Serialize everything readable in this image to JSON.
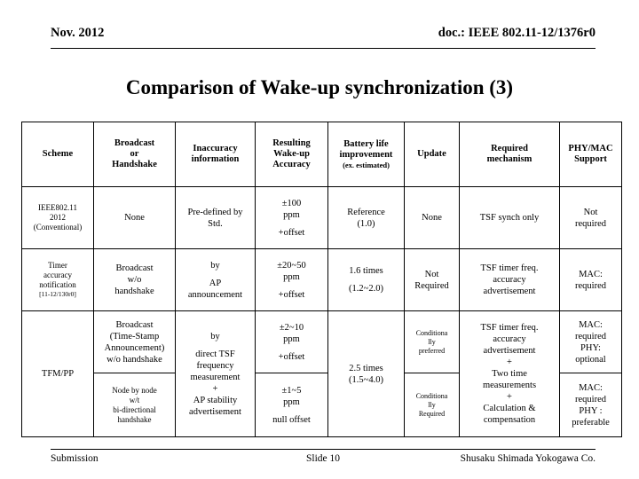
{
  "header": {
    "date": "Nov. 2012",
    "doc": "doc.: IEEE 802.11-12/1376r0"
  },
  "title": "Comparison of Wake-up synchronization (3)",
  "table": {
    "columns": [
      "Scheme",
      "Broadcast or Handshake",
      "Inaccuracy information",
      "Resulting Wake-up Accuracy",
      "Battery life improvement (ex. estimated)",
      "Update",
      "Required mechanism",
      "PHY/MAC Support"
    ],
    "header_cells": {
      "scheme": "Scheme",
      "broadcast_l1": "Broadcast",
      "broadcast_l2": "or",
      "broadcast_l3": "Handshake",
      "inaccuracy_l1": "Inaccuracy",
      "inaccuracy_l2": "information",
      "accuracy_l1": "Resulting",
      "accuracy_l2": "Wake-up",
      "accuracy_l3": "Accuracy",
      "battery_l1": "Battery life",
      "battery_l2": "improvement",
      "battery_l3": "(ex. estimated)",
      "update": "Update",
      "mechanism_l1": "Required",
      "mechanism_l2": "mechanism",
      "phymac_l1": "PHY/MAC",
      "phymac_l2": "Support"
    },
    "row1": {
      "scheme_l1": "IEEE802.11",
      "scheme_l2": "2012",
      "scheme_l3": "(Conventional)",
      "broadcast": "None",
      "inaccuracy_l1": "Pre-defined by",
      "inaccuracy_l2": "Std.",
      "accuracy_l1": "±100",
      "accuracy_l2": "ppm",
      "accuracy_l3": "+offset",
      "battery_l1": "Reference",
      "battery_l2": "(1.0)",
      "update": "None",
      "mechanism": "TSF synch only",
      "phymac_l1": "Not",
      "phymac_l2": "required"
    },
    "row2": {
      "scheme_l1": "Timer",
      "scheme_l2": "accuracy",
      "scheme_l3": "notification",
      "scheme_l4": "[11-12/130r0]",
      "broadcast_l1": "Broadcast",
      "broadcast_l2": "w/o",
      "broadcast_l3": "handshake",
      "inaccuracy_l1": "by",
      "inaccuracy_l2": "AP",
      "inaccuracy_l3": "announcement",
      "accuracy_l1": "±20~50",
      "accuracy_l2": "ppm",
      "accuracy_l3": "+offset",
      "battery_l1": "1.6 times",
      "battery_l2": "(1.2~2.0)",
      "update_l1": "Not",
      "update_l2": "Required",
      "mechanism_l1": "TSF timer freq.",
      "mechanism_l2": "accuracy",
      "mechanism_l3": "advertisement",
      "phymac_l1": "MAC:",
      "phymac_l2": "required"
    },
    "row3": {
      "scheme": "TFM/PP",
      "broadcast_a_l1": "Broadcast",
      "broadcast_a_l2": "(Time-Stamp",
      "broadcast_a_l3": "Announcement)",
      "broadcast_a_l4": "w/o handshake",
      "broadcast_b_l1": "Node by node",
      "broadcast_b_l2": "w/t",
      "broadcast_b_l3": "bi-directional",
      "broadcast_b_l4": "handshake",
      "inaccuracy_l1": "by",
      "inaccuracy_l2": "direct TSF",
      "inaccuracy_l3": "frequency",
      "inaccuracy_l4": "measurement",
      "inaccuracy_l5": "+",
      "inaccuracy_l6": "AP stability",
      "inaccuracy_l7": "advertisement",
      "accuracy_a_l1": "±2~10",
      "accuracy_a_l2": "ppm",
      "accuracy_a_l3": "+offset",
      "accuracy_b_l1": "±1~5",
      "accuracy_b_l2": "ppm",
      "accuracy_b_l3": "null offset",
      "battery_l1": "2.5 times",
      "battery_l2": "(1.5~4.0)",
      "update_a_l1": "Conditiona",
      "update_a_l2": "lly",
      "update_a_l3": "preferred",
      "update_b_l1": "Conditiona",
      "update_b_l2": "lly",
      "update_b_l3": "Required",
      "mechanism_l1": "TSF timer freq.",
      "mechanism_l2": "accuracy",
      "mechanism_l3": "advertisement",
      "mechanism_l4": "+",
      "mechanism_l5": "Two time",
      "mechanism_l6": "measurements",
      "mechanism_l7": "+",
      "mechanism_l8": "Calculation &",
      "mechanism_l9": "compensation",
      "phymac_a_l1": "MAC:",
      "phymac_a_l2": "required",
      "phymac_a_l3": "PHY:",
      "phymac_a_l4": "optional",
      "phymac_b_l1": "MAC:",
      "phymac_b_l2": "required",
      "phymac_b_l3": "PHY :",
      "phymac_b_l4": "preferable"
    }
  },
  "footer": {
    "left": "Submission",
    "center": "Slide 10",
    "right": "Shusaku Shimada Yokogawa Co."
  }
}
